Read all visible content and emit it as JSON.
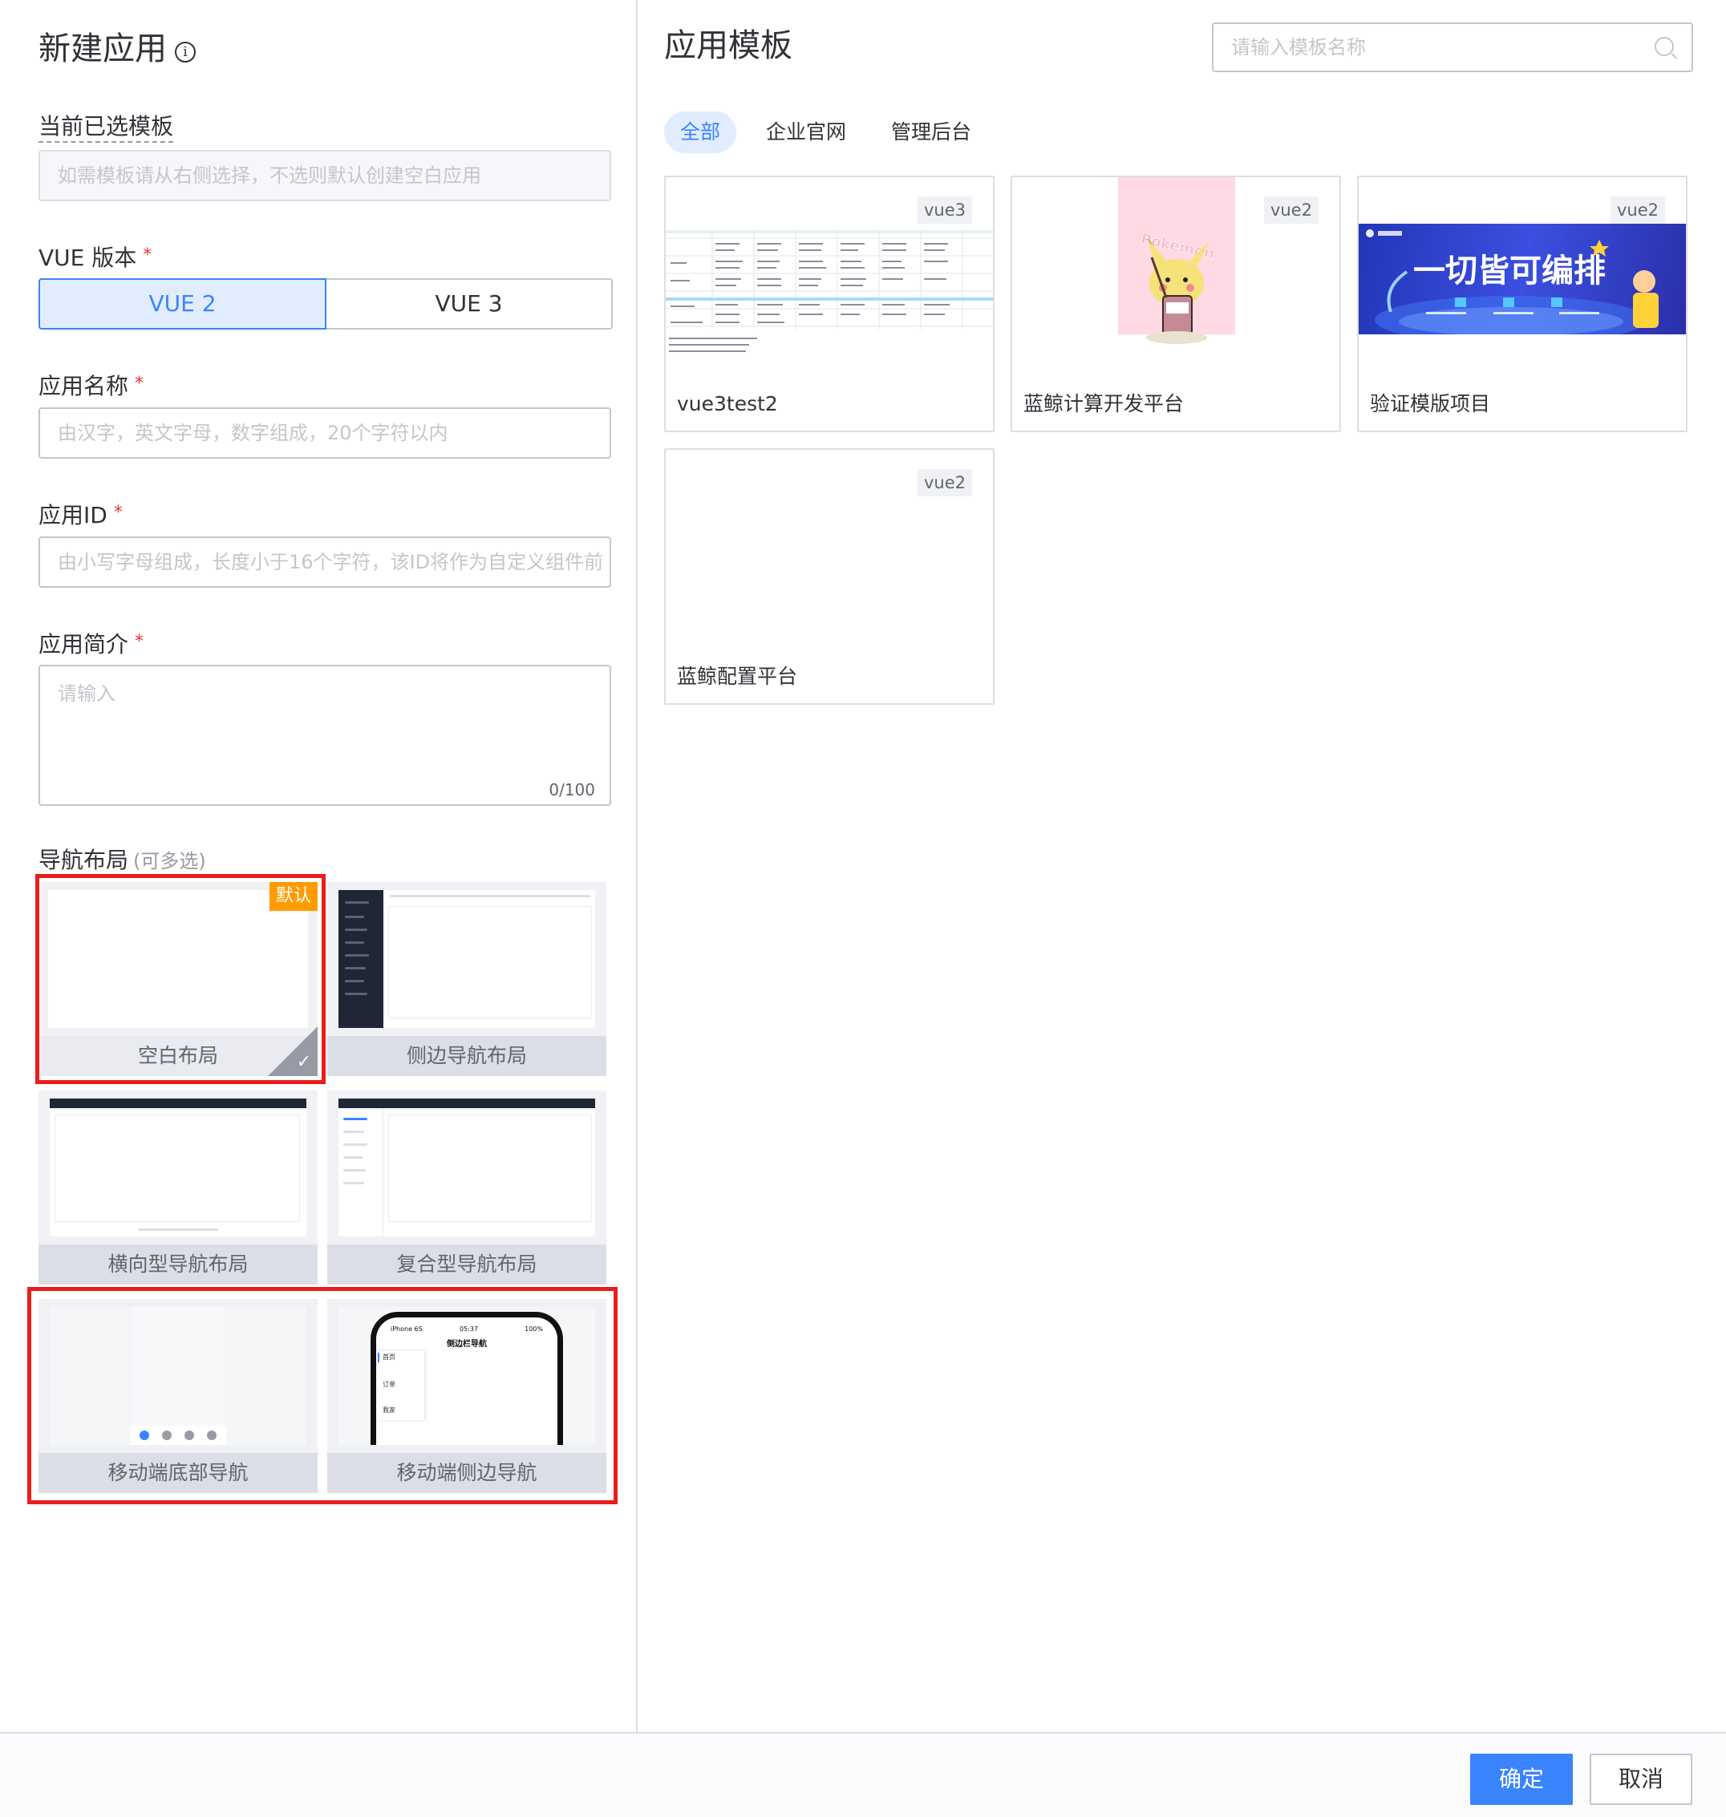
{
  "dialog": {
    "title": "新建应用"
  },
  "form": {
    "template_label": "当前已选模板",
    "template_placeholder": "如需模板请从右侧选择，不选则默认创建空白应用",
    "vue_label": "VUE 版本",
    "vue_options": [
      "VUE 2",
      "VUE 3"
    ],
    "vue_selected": "VUE 2",
    "name_label": "应用名称",
    "name_placeholder": "由汉字，英文字母，数字组成，20个字符以内",
    "id_label": "应用ID",
    "id_placeholder": "由小写字母组成，长度小于16个字符，该ID将作为自定义组件前",
    "desc_label": "应用简介",
    "desc_placeholder": "请输入",
    "desc_counter": "0/100",
    "required_mark": "*",
    "nav_label": "导航布局",
    "nav_hint": "(可多选)",
    "layouts": [
      {
        "label": "空白布局",
        "badge": "默认",
        "selected": true
      },
      {
        "label": "侧边导航布局"
      },
      {
        "label": "横向型导航布局"
      },
      {
        "label": "复合型导航布局"
      },
      {
        "label": "移动端底部导航"
      },
      {
        "label": "移动端侧边导航",
        "phone_carrier": "iPhone 6S",
        "phone_time": "05:37",
        "phone_battery": "100%",
        "phone_title": "侧边栏导航",
        "phone_items": [
          "首页",
          "订单",
          "我家"
        ]
      }
    ]
  },
  "templates": {
    "title": "应用模板",
    "search_placeholder": "请输入模板名称",
    "tabs": [
      "全部",
      "企业官网",
      "管理后台"
    ],
    "active_tab": "全部",
    "cards": [
      {
        "name": "vue3test2",
        "tag": "vue3"
      },
      {
        "name": "蓝鲸计算开发平台",
        "tag": "vue2",
        "preview_text": "Pokémon"
      },
      {
        "name": "验证模版项目",
        "tag": "vue2",
        "preview_text": "一切皆可编排"
      },
      {
        "name": "蓝鲸配置平台",
        "tag": "vue2"
      }
    ]
  },
  "footer": {
    "confirm": "确定",
    "cancel": "取消"
  },
  "colors": {
    "primary": "#3a84ff",
    "highlight": "#ea1c1c",
    "badge": "#ff9c01"
  }
}
